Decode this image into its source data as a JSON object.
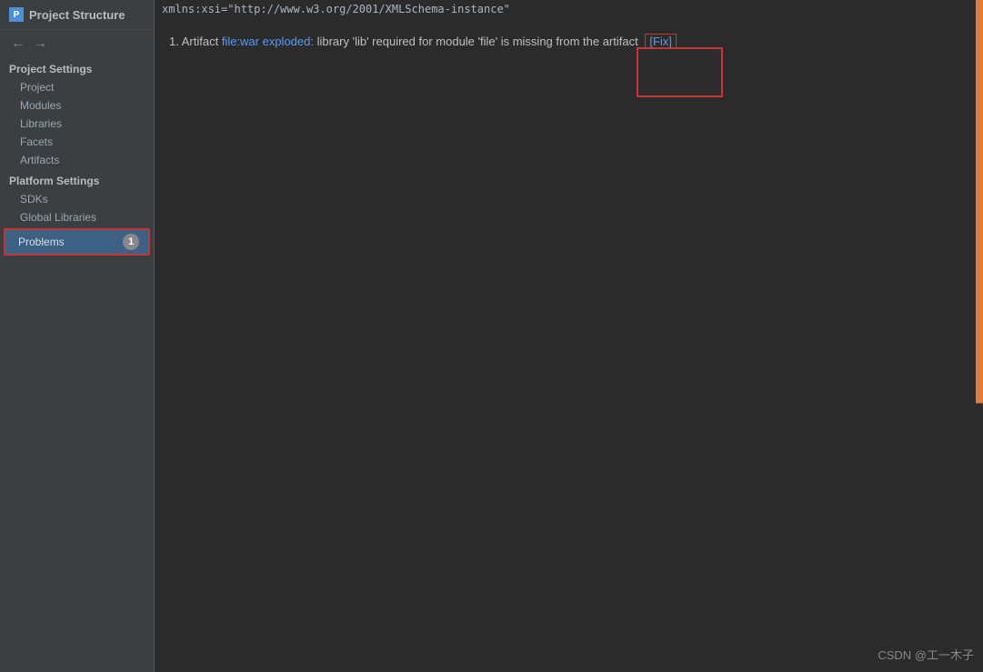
{
  "window": {
    "title": "Project Structure",
    "title_icon": "P"
  },
  "nav": {
    "back_label": "←",
    "forward_label": "→"
  },
  "sidebar": {
    "project_settings_header": "Project Settings",
    "items": [
      {
        "id": "project",
        "label": "Project"
      },
      {
        "id": "modules",
        "label": "Modules"
      },
      {
        "id": "libraries",
        "label": "Libraries"
      },
      {
        "id": "facets",
        "label": "Facets"
      },
      {
        "id": "artifacts",
        "label": "Artifacts"
      }
    ],
    "platform_settings_header": "Platform Settings",
    "platform_items": [
      {
        "id": "sdks",
        "label": "SDKs"
      },
      {
        "id": "global-libraries",
        "label": "Global Libraries"
      }
    ],
    "problems_label": "Problems",
    "problems_count": "1"
  },
  "code_header": {
    "text": "xmlns:xsi=\"http://www.w3.org/2001/XMLSchema-instance\""
  },
  "main": {
    "problem_prefix": "1. Artifact ",
    "problem_link_text": "file:war exploded:",
    "problem_suffix": " library 'lib' required for module 'file' is missing from the artifact",
    "fix_label": "[Fix]"
  },
  "watermark": {
    "text": "CSDN @工一木子"
  }
}
